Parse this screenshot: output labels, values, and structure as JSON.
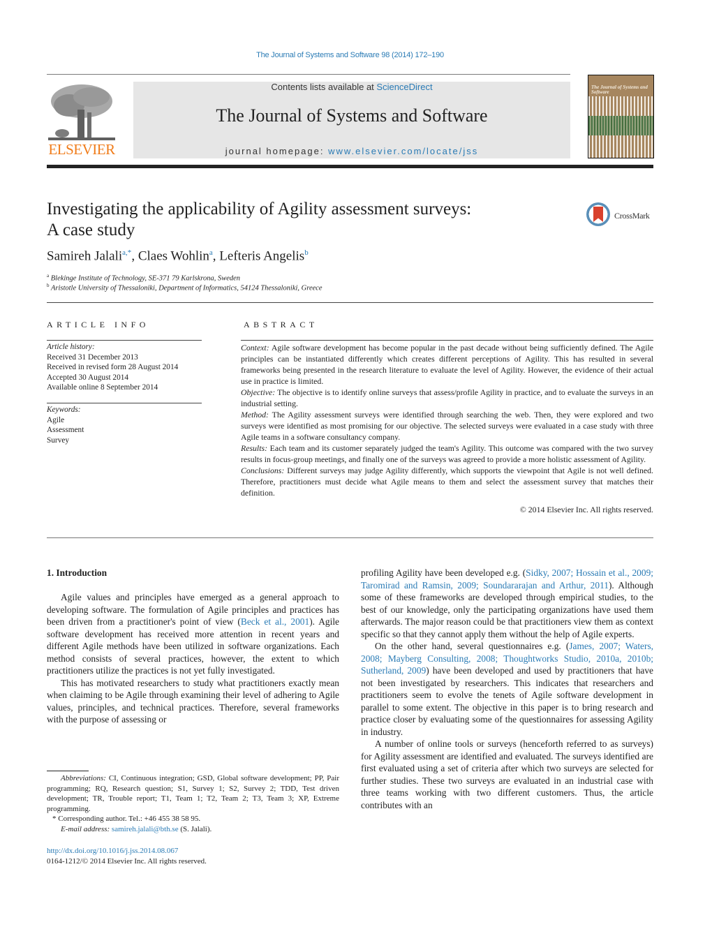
{
  "header": {
    "journal_reference": "The Journal of Systems and Software 98 (2014) 172–190",
    "contents_prefix": "Contents lists available at ",
    "contents_link": "ScienceDirect",
    "journal_title": "The Journal of Systems and Software",
    "homepage_prefix": "journal homepage: ",
    "homepage_link": "www.elsevier.com/locate/jss",
    "publisher_logo": "ELSEVIER",
    "cover_title": "The Journal of Systems and Software",
    "colors": {
      "link": "#2a7bb5",
      "elsevier_orange": "#f07c1a",
      "header_box": "#e6e6e6"
    }
  },
  "article": {
    "title_line1": "Investigating the applicability of Agility assessment surveys:",
    "title_line2": "A case study",
    "crossmark_label": "CrossMark",
    "authors": [
      {
        "name": "Samireh Jalali",
        "sup": "a,*"
      },
      {
        "name": "Claes Wohlin",
        "sup": "a"
      },
      {
        "name": "Lefteris Angelis",
        "sup": "b"
      }
    ],
    "affiliations": [
      {
        "mark": "a",
        "text": "Blekinge Institute of Technology, SE-371 79 Karlskrona, Sweden"
      },
      {
        "mark": "b",
        "text": "Aristotle University of Thessaloniki, Department of Informatics, 54124 Thessaloniki, Greece"
      }
    ]
  },
  "article_info": {
    "heading": "ARTICLE INFO",
    "history_label": "Article history:",
    "history": [
      "Received 31 December 2013",
      "Received in revised form 28 August 2014",
      "Accepted 30 August 2014",
      "Available online 8 September 2014"
    ],
    "keywords_label": "Keywords:",
    "keywords": [
      "Agile",
      "Assessment",
      "Survey"
    ]
  },
  "abstract": {
    "heading": "ABSTRACT",
    "sections": [
      {
        "label": "Context:",
        "text": " Agile software development has become popular in the past decade without being sufficiently defined. The Agile principles can be instantiated differently which creates different perceptions of Agility. This has resulted in several frameworks being presented in the research literature to evaluate the level of Agility. However, the evidence of their actual use in practice is limited."
      },
      {
        "label": "Objective:",
        "text": " The objective is to identify online surveys that assess/profile Agility in practice, and to evaluate the surveys in an industrial setting."
      },
      {
        "label": "Method:",
        "text": " The Agility assessment surveys were identified through searching the web. Then, they were explored and two surveys were identified as most promising for our objective. The selected surveys were evaluated in a case study with three Agile teams in a software consultancy company."
      },
      {
        "label": "Results:",
        "text": " Each team and its customer separately judged the team's Agility. This outcome was compared with the two survey results in focus-group meetings, and finally one of the surveys was agreed to provide a more holistic assessment of Agility."
      },
      {
        "label": "Conclusions:",
        "text": " Different surveys may judge Agility differently, which supports the viewpoint that Agile is not well defined. Therefore, practitioners must decide what Agile means to them and select the assessment survey that matches their definition."
      }
    ],
    "copyright": "© 2014 Elsevier Inc. All rights reserved."
  },
  "body": {
    "section_heading": "1.  Introduction",
    "left": {
      "p1_a": "Agile values and principles have emerged as a general approach to developing software. The formulation of Agile principles and practices has been driven from a practitioner's point of view (",
      "p1_cite": "Beck et al., 2001",
      "p1_b": "). Agile software development has received more attention in recent years and different Agile methods have been utilized in software organizations. Each method consists of several practices, however, the extent to which practitioners utilize the practices is not yet fully investigated.",
      "p2": "This has motivated researchers to study what practitioners exactly mean when claiming to be Agile through examining their level of adhering to Agile values, principles, and technical practices. Therefore, several frameworks with the purpose of assessing or"
    },
    "right": {
      "p1_a": "profiling Agility have been developed e.g. (",
      "p1_cite": "Sidky, 2007; Hossain et al., 2009; Taromirad and Ramsin, 2009; Soundararajan and Arthur, 2011",
      "p1_b": "). Although some of these frameworks are developed through empirical studies, to the best of our knowledge, only the participating organizations have used them afterwards. The major reason could be that practitioners view them as context specific so that they cannot apply them without the help of Agile experts.",
      "p2_a": "On the other hand, several questionnaires e.g. (",
      "p2_cite": "James, 2007; Waters, 2008; Mayberg Consulting, 2008; Thoughtworks Studio, 2010a, 2010b; Sutherland, 2009",
      "p2_b": ") have been developed and used by practitioners that have not been investigated by researchers. This indicates that researchers and practitioners seem to evolve the tenets of Agile software development in parallel to some extent. The objective in this paper is to bring research and practice closer by evaluating some of the questionnaires for assessing Agility in industry.",
      "p3": "A number of online tools or surveys (henceforth referred to as surveys) for Agility assessment are identified and evaluated. The surveys identified are first evaluated using a set of criteria after which two surveys are selected for further studies. These two surveys are evaluated in an industrial case with three teams working with two different customers. Thus, the article contributes with an"
    }
  },
  "footnotes": {
    "abbrev_label": "Abbreviations:",
    "abbrev_text": " CI, Continuous integration; GSD, Global software development; PP, Pair programming; RQ, Research question; S1, Survey 1; S2, Survey 2; TDD, Test driven development; TR, Trouble report; T1, Team 1; T2, Team 2; T3, Team 3; XP, Extreme programming.",
    "corresponding": "* Corresponding author. Tel.: +46 455 38 58 95.",
    "email_label": "E-mail address:",
    "email": "samireh.jalali@bth.se",
    "email_suffix": " (S. Jalali).",
    "doi": "http://dx.doi.org/10.1016/j.jss.2014.08.067",
    "issn_line": "0164-1212/© 2014 Elsevier Inc. All rights reserved."
  }
}
